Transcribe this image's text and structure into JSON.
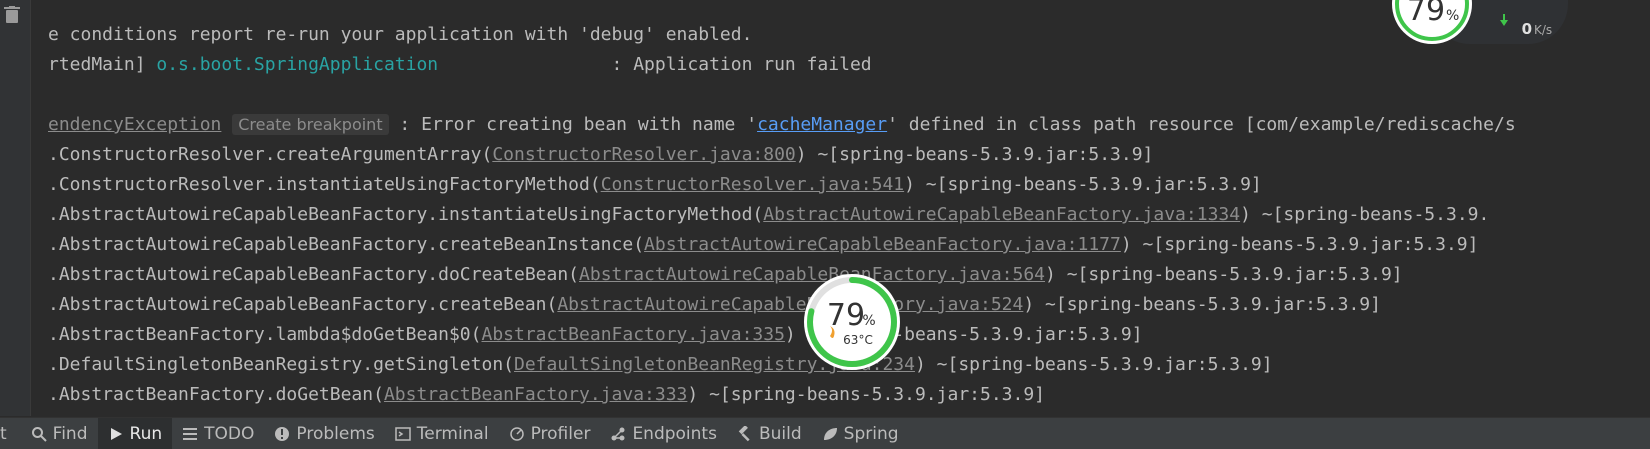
{
  "console": {
    "line1": "e conditions report re-run your application with 'debug' enabled.",
    "line2_prefix": "rtedMain] ",
    "line2_logger": "o.s.boot.SpringApplication",
    "line2_pad": "                ",
    "line2_msg": ": Application run failed",
    "line3_exc": "endencyException",
    "line3_hint": "Create breakpoint",
    "line3_msg1": " : Error creating bean with name '",
    "line3_bean": "cacheManager",
    "line3_msg2": "' defined in class path resource [com/example/rediscache/s",
    "frames": [
      {
        "method": ".ConstructorResolver.createArgumentArray(",
        "src": "ConstructorResolver.java:800",
        "jar": ") ~[spring-beans-5.3.9.jar:5.3.9]"
      },
      {
        "method": ".ConstructorResolver.instantiateUsingFactoryMethod(",
        "src": "ConstructorResolver.java:541",
        "jar": ") ~[spring-beans-5.3.9.jar:5.3.9]"
      },
      {
        "method": ".AbstractAutowireCapableBeanFactory.instantiateUsingFactoryMethod(",
        "src": "AbstractAutowireCapableBeanFactory.java:1334",
        "jar": ") ~[spring-beans-5.3.9."
      },
      {
        "method": ".AbstractAutowireCapableBeanFactory.createBeanInstance(",
        "src": "AbstractAutowireCapableBeanFactory.java:1177",
        "jar": ") ~[spring-beans-5.3.9.jar:5.3.9]"
      },
      {
        "method": ".AbstractAutowireCapableBeanFactory.doCreateBean(",
        "src": "AbstractAutowireCapableBeanFactory.java:564",
        "jar": ") ~[spring-beans-5.3.9.jar:5.3.9]"
      },
      {
        "method": ".AbstractAutowireCapableBeanFactory.createBean(",
        "src": "AbstractAutowireCapableBeanFactory.java:524",
        "jar": ") ~[spring-beans-5.3.9.jar:5.3.9]"
      },
      {
        "method": ".AbstractBeanFactory.lambda$doGetBean$0(",
        "src": "AbstractBeanFactory.java:335",
        "jar": ") ~[spring-beans-5.3.9.jar:5.3.9]"
      },
      {
        "method": ".DefaultSingletonBeanRegistry.getSingleton(",
        "src": "DefaultSingletonBeanRegistry.java:234",
        "jar": ") ~[spring-beans-5.3.9.jar:5.3.9]"
      },
      {
        "method": ".AbstractBeanFactory.doGetBean(",
        "src": "AbstractBeanFactory.java:333",
        "jar": ") ~[spring-beans-5.3.9.jar:5.3.9]"
      }
    ]
  },
  "toolbar": {
    "items": [
      {
        "label": "t",
        "icon": "none"
      },
      {
        "label": "Find",
        "icon": "search-icon"
      },
      {
        "label": "Run",
        "icon": "play-icon"
      },
      {
        "label": "TODO",
        "icon": "list-icon"
      },
      {
        "label": "Problems",
        "icon": "warning-icon"
      },
      {
        "label": "Terminal",
        "icon": "terminal-icon"
      },
      {
        "label": "Profiler",
        "icon": "profiler-icon"
      },
      {
        "label": "Endpoints",
        "icon": "endpoints-icon"
      },
      {
        "label": "Build",
        "icon": "hammer-icon"
      },
      {
        "label": "Spring",
        "icon": "leaf-icon"
      }
    ]
  },
  "gauge_main": {
    "percent_text": "79",
    "percent_sign": "%",
    "temp": "63°C",
    "percent_value": 79
  },
  "gauge_top": {
    "percent_text": "79",
    "percent_sign": "%",
    "net_speed": "0",
    "net_unit": "K/s"
  },
  "colors": {
    "accent_green": "#3fc54a",
    "link_blue": "#589df6",
    "logger_cyan": "#29a3a3"
  }
}
